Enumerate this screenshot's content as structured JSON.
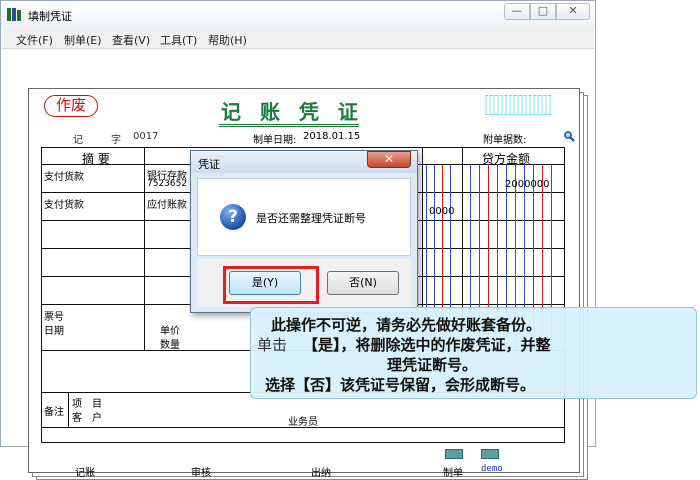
{
  "window": {
    "title": "填制凭证",
    "controls": {
      "minimize": "—",
      "maximize": "□",
      "close": "✕"
    }
  },
  "menu": [
    "文件(F)",
    "制单(E)",
    "查看(V)",
    "工具(T)",
    "帮助(H)"
  ],
  "voucher": {
    "void_stamp": "作废",
    "title": "记 账 凭 证",
    "type_label": "记",
    "number_label": "字",
    "number": "0017",
    "date_label": "制单日期:",
    "date": "2018.01.15",
    "attachments_label": "附单据数:",
    "columns": {
      "summary": "摘 要",
      "credit": "贷方金额"
    },
    "rows": [
      {
        "summary": "支付货款",
        "account": "银行存款",
        "account_sub": "7523652",
        "credit": "2000000"
      },
      {
        "summary": "支付货款",
        "account": "应付账款",
        "account_sub": "",
        "debit_tail": "0000"
      }
    ],
    "footer": {
      "ticket_no": "票号",
      "date": "日期",
      "unit_price": "单价",
      "quantity": "数量",
      "remarks": "备注",
      "project": "项　目",
      "customer": "客　户",
      "salesperson": "业务员"
    },
    "signatures": {
      "bookkeeping": "记账",
      "audit": "审核",
      "cashier": "出纳",
      "preparer_label": "制单",
      "preparer": "demo"
    }
  },
  "dialog": {
    "title": "凭证",
    "close": "✕",
    "icon": "question-icon",
    "message": "是否还需整理凭证断号",
    "yes_label": "是(Y)",
    "no_label": "否(N)"
  },
  "annotation": {
    "line1": "此操作不可逆，请务必先做好账套备份。",
    "line2_prefix": "单击",
    "line2": "【是】，将删除选中的作废凭证，并整",
    "line3": "理凭证断号。",
    "line4": "选择【否】该凭证号保留，会形成断号。"
  },
  "colors": {
    "accent_green": "#1a7a3a",
    "void_red": "#d01010",
    "highlight_red": "#e02020",
    "panel_blue": "#d7f0fc"
  }
}
